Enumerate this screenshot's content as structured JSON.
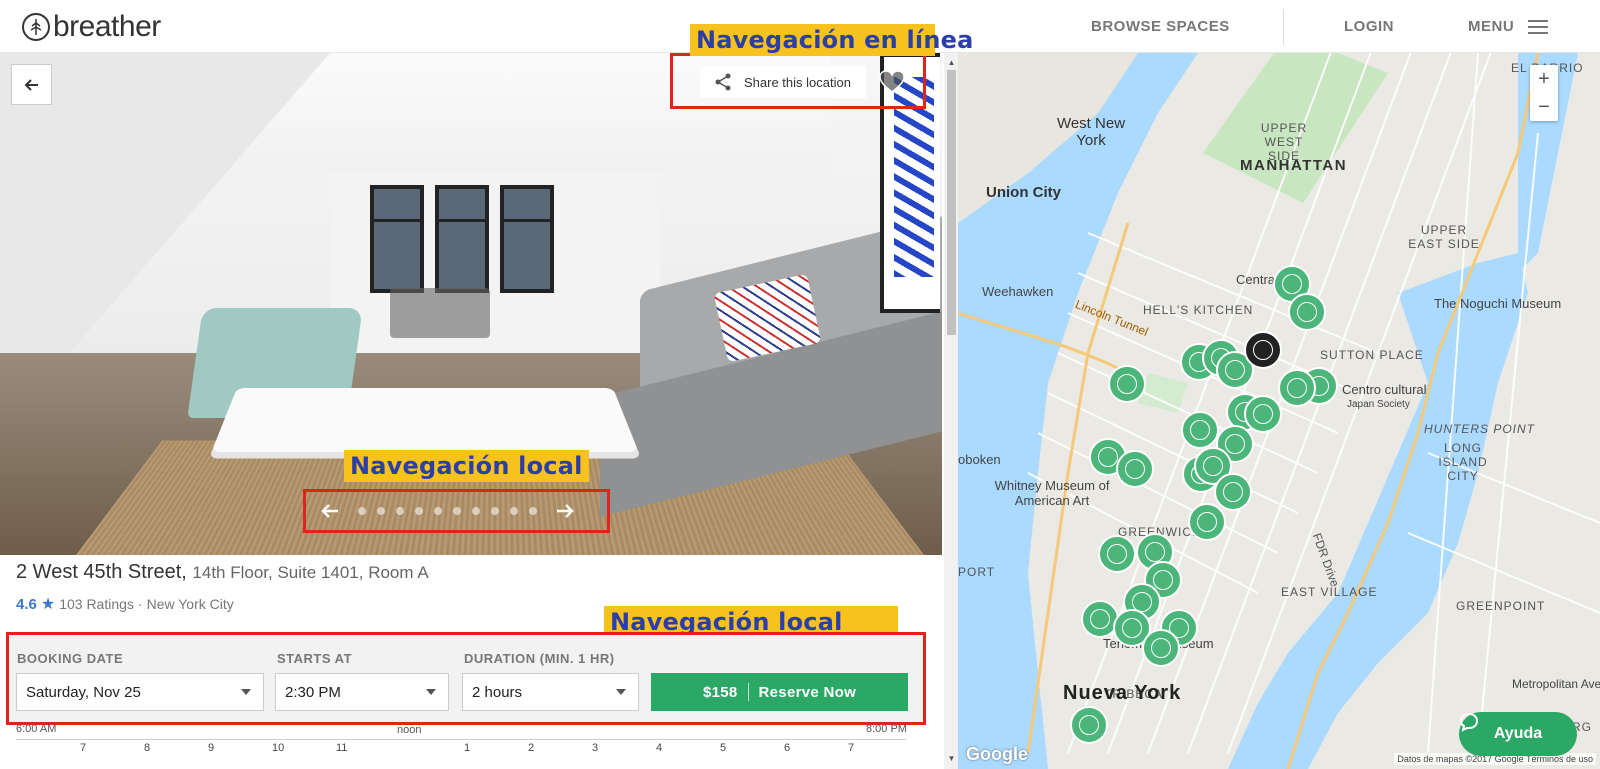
{
  "header": {
    "logo_text": "breather",
    "nav": {
      "browse": "BROWSE SPACES",
      "login": "LOGIN",
      "menu": "MENU"
    }
  },
  "photo": {
    "share_label": "Share this location",
    "carousel_dot_count": 10
  },
  "annotations": {
    "top": "Navegación en línea",
    "carousel": "Navegación local",
    "booking": "Navegación local"
  },
  "listing": {
    "street": "2 West 45th Street,",
    "unit": "14th Floor, Suite 1401, Room A",
    "rating": "4.6",
    "ratings_count": "103 Ratings",
    "separator": "·",
    "city": "New York City"
  },
  "booking": {
    "date_label": "BOOKING DATE",
    "date_value": "Saturday, Nov 25",
    "start_label": "STARTS AT",
    "start_value": "2:30 PM",
    "duration_label": "DURATION (MIN. 1 HR)",
    "duration_value": "2 hours",
    "price": "$158",
    "reserve_label": "Reserve Now"
  },
  "timeline": {
    "start": "6:00 AM",
    "noon": "noon",
    "end": "8:00 PM",
    "ticks": [
      "7",
      "8",
      "9",
      "10",
      "11",
      "1",
      "2",
      "3",
      "4",
      "5",
      "6",
      "7"
    ]
  },
  "map": {
    "labels": {
      "el_barrio": "EL BARRIO",
      "west_new_york": "West New York",
      "upper_west_side": "UPPER WEST SIDE",
      "manhattan": "MANHATTAN",
      "union_city": "Union City",
      "upper_east_side": "UPPER EAST SIDE",
      "central_park": "Central Park",
      "weehawken": "Weehawken",
      "lincoln_tunnel": "Lincoln Tunnel",
      "hells_kitchen": "HELL'S KITCHEN",
      "noguchi": "The Noguchi Museum",
      "sutton_place": "SUTTON PLACE",
      "centro_cultural": "Centro cultural",
      "japan_society": "Japan Society",
      "hunters_point": "HUNTERS POINT",
      "long_island_city": "LONG ISLAND CITY",
      "hoboken": "oboken",
      "whitney": "Whitney Museum of American Art",
      "greenwich": "GREENWICH",
      "port": "PORT",
      "east_village": "EAST VILLAGE",
      "greenpoint": "GREENPOINT",
      "tenement": "Tenement Museum",
      "tribeca": "TRIBECA",
      "nueva_york": "Nueva York",
      "williamsburg": "WILLIAMSBURG",
      "metropolitan": "Metropolitan Ave",
      "fdr_drive": "FDR Drive"
    },
    "zoom_in": "+",
    "zoom_out": "−",
    "google": "Google",
    "attribution": "Datos de mapas ©2017 Google  Términos de uso",
    "help_label": "Ayuda"
  },
  "colors": {
    "accent_green": "#2ca866",
    "rating_blue": "#3a78c8",
    "annotation_red": "#e2231a",
    "annotation_yellow": "#f7c21d",
    "annotation_text": "#2c3fa8"
  }
}
